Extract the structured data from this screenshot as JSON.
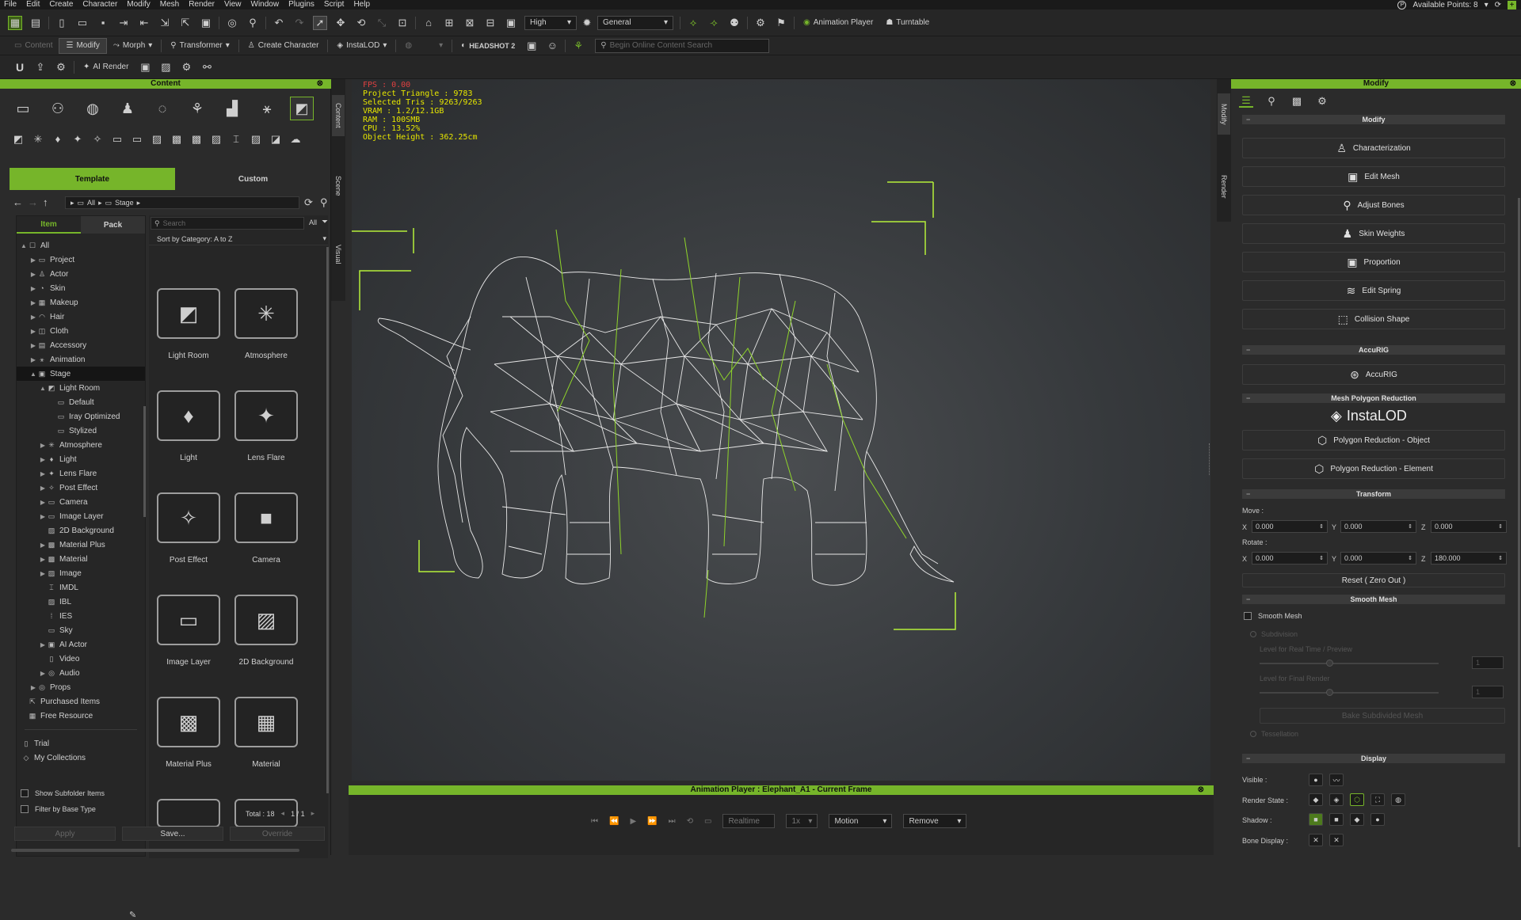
{
  "menu": [
    "File",
    "Edit",
    "Create",
    "Character",
    "Modify",
    "Mesh",
    "Render",
    "View",
    "Window",
    "Plugins",
    "Script",
    "Help"
  ],
  "account": {
    "points_label": "Available Points: 8"
  },
  "toolbar1": {
    "quality": "High",
    "preset": "General",
    "animation_player": "Animation Player",
    "turntable": "Turntable"
  },
  "toolbar2": {
    "content": "Content",
    "modify": "Modify",
    "morph": "Morph",
    "transformer": "Transformer",
    "create_character": "Create Character",
    "instalod": "InstaLOD",
    "headshot2": "HEADSHOT 2",
    "search_placeholder": "Begin Online Content Search"
  },
  "toolbar3": {
    "ai_render": "AI Render"
  },
  "content_panel": {
    "title": "Content",
    "side_tabs": [
      "Content",
      "Scene",
      "Visual"
    ],
    "tabs": {
      "template": "Template",
      "custom": "Custom"
    },
    "breadcrumb": [
      "All",
      "Stage"
    ],
    "subtabs": {
      "item": "Item",
      "pack": "Pack"
    },
    "search_placeholder": "Search",
    "filter_all": "All",
    "sort_label": "Sort by Category: A to Z",
    "tree": [
      {
        "label": "All",
        "level": 0,
        "arrow": "▲",
        "icon": "☐"
      },
      {
        "label": "Project",
        "level": 1,
        "arrow": "▶",
        "icon": "▭"
      },
      {
        "label": "Actor",
        "level": 1,
        "arrow": "▶",
        "icon": "♙"
      },
      {
        "label": "Skin",
        "level": 1,
        "arrow": "▶",
        "icon": "◔"
      },
      {
        "label": "Makeup",
        "level": 1,
        "arrow": "▶",
        "icon": "▦"
      },
      {
        "label": "Hair",
        "level": 1,
        "arrow": "▶",
        "icon": "◠"
      },
      {
        "label": "Cloth",
        "level": 1,
        "arrow": "▶",
        "icon": "◫"
      },
      {
        "label": "Accessory",
        "level": 1,
        "arrow": "▶",
        "icon": "▤"
      },
      {
        "label": "Animation",
        "level": 1,
        "arrow": "▶",
        "icon": "⚹"
      },
      {
        "label": "Stage",
        "level": 1,
        "arrow": "▲",
        "icon": "▣",
        "selected": true
      },
      {
        "label": "Light Room",
        "level": 2,
        "arrow": "▲",
        "icon": "◩"
      },
      {
        "label": "Default",
        "level": 3,
        "arrow": "",
        "icon": "▭"
      },
      {
        "label": "Iray Optimized",
        "level": 3,
        "arrow": "",
        "icon": "▭"
      },
      {
        "label": "Stylized",
        "level": 3,
        "arrow": "",
        "icon": "▭"
      },
      {
        "label": "Atmosphere",
        "level": 2,
        "arrow": "▶",
        "icon": "✳"
      },
      {
        "label": "Light",
        "level": 2,
        "arrow": "▶",
        "icon": "♦"
      },
      {
        "label": "Lens Flare",
        "level": 2,
        "arrow": "▶",
        "icon": "✦"
      },
      {
        "label": "Post Effect",
        "level": 2,
        "arrow": "▶",
        "icon": "✧"
      },
      {
        "label": "Camera",
        "level": 2,
        "arrow": "▶",
        "icon": "▭"
      },
      {
        "label": "Image Layer",
        "level": 2,
        "arrow": "▶",
        "icon": "▭"
      },
      {
        "label": "2D Background",
        "level": 2,
        "arrow": "",
        "icon": "▨"
      },
      {
        "label": "Material Plus",
        "level": 2,
        "arrow": "▶",
        "icon": "▩"
      },
      {
        "label": "Material",
        "level": 2,
        "arrow": "▶",
        "icon": "▩"
      },
      {
        "label": "Image",
        "level": 2,
        "arrow": "▶",
        "icon": "▨"
      },
      {
        "label": "IMDL",
        "level": 2,
        "arrow": "",
        "icon": "⌶"
      },
      {
        "label": "IBL",
        "level": 2,
        "arrow": "",
        "icon": "▨"
      },
      {
        "label": "IES",
        "level": 2,
        "arrow": "",
        "icon": "⁞"
      },
      {
        "label": "Sky",
        "level": 2,
        "arrow": "",
        "icon": "▭"
      },
      {
        "label": "AI Actor",
        "level": 2,
        "arrow": "▶",
        "icon": "▣"
      },
      {
        "label": "Video",
        "level": 2,
        "arrow": "",
        "icon": "▯"
      },
      {
        "label": "Audio",
        "level": 2,
        "arrow": "▶",
        "icon": "◎"
      },
      {
        "label": "Props",
        "level": 1,
        "arrow": "▶",
        "icon": "◎"
      },
      {
        "label": "Purchased Items",
        "level": 0,
        "arrow": "",
        "icon": "⇱"
      },
      {
        "label": "Free Resource",
        "level": 0,
        "arrow": "",
        "icon": "▦"
      }
    ],
    "tree_bottom": [
      {
        "label": "Trial",
        "icon": "▯"
      },
      {
        "label": "My Collections",
        "icon": "◇"
      }
    ],
    "show_subfolder": "Show Subfolder Items",
    "filter_base": "Filter by Base Type",
    "apply": "Apply",
    "save": "Save...",
    "override": "Override",
    "tiles": [
      "Light Room",
      "Atmosphere",
      "Light",
      "Lens Flare",
      "Post Effect",
      "Camera",
      "Image Layer",
      "2D Background",
      "Material Plus",
      "Material"
    ],
    "total_label": "Total : 18",
    "page": "1 / 1"
  },
  "viewport": {
    "stats": [
      "FPS : 0.00",
      "Project Triangle : 9783",
      "Selected Tris : 9263/9263",
      "VRAM : 1.2/12.1GB",
      "RAM : 100SMB",
      "CPU : 13.52%",
      "Object Height : 362.25cm"
    ],
    "fps_color": "#e04040",
    "stat_color": "#e6e600"
  },
  "anim_player": {
    "title": "Animation Player : Elephant_A1 - Current Frame",
    "realtime": "Realtime",
    "speed": "1x",
    "motion": "Motion",
    "remove": "Remove"
  },
  "modify_panel": {
    "title": "Modify",
    "side_tabs": [
      "Modify",
      "Render"
    ],
    "section_modify": "Modify",
    "buttons": [
      "Characterization",
      "Edit Mesh",
      "Adjust Bones",
      "Skin Weights",
      "Proportion",
      "Edit Spring",
      "Collision Shape"
    ],
    "section_accurig": "AccuRIG",
    "accurig_btn": "AccuRIG",
    "section_mpr": "Mesh Polygon Reduction",
    "instalod_logo": "InstaLOD",
    "poly_obj": "Polygon Reduction - Object",
    "poly_elem": "Polygon Reduction - Element",
    "section_transform": "Transform",
    "move_label": "Move :",
    "rotate_label": "Rotate :",
    "move": {
      "x": "0.000",
      "y": "0.000",
      "z": "0.000"
    },
    "rotate": {
      "x": "0.000",
      "y": "0.000",
      "z": "180.000"
    },
    "reset": "Reset ( Zero Out )",
    "section_smooth": "Smooth Mesh",
    "smooth_mesh": "Smooth Mesh",
    "subdivision": "Subdivision",
    "level_realtime": "Level for Real Time / Preview",
    "level_final": "Level for Final Render",
    "level_realtime_val": "1",
    "level_final_val": "1",
    "bake": "Bake Subdivided Mesh",
    "tessellation": "Tessellation",
    "section_display": "Display",
    "visible": "Visible :",
    "render_state": "Render State :",
    "shadow": "Shadow :",
    "bone_display": "Bone Display :"
  },
  "colors": {
    "accent": "#76b52a",
    "viewport_bg": "#3a3d40"
  }
}
